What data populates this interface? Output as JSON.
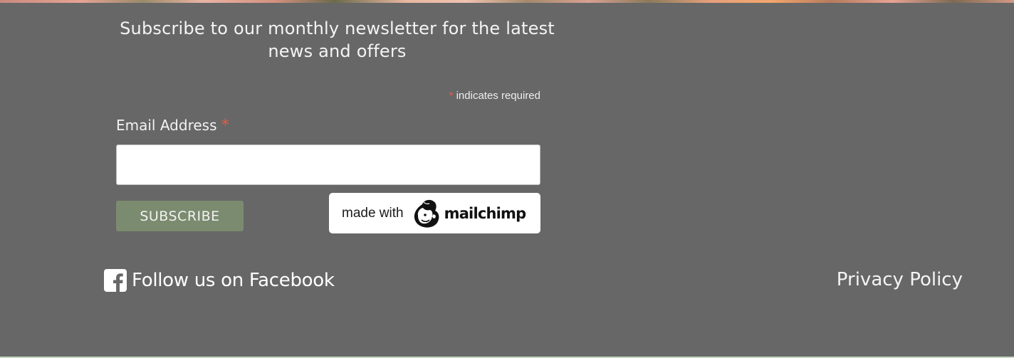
{
  "newsletter": {
    "heading_line1": "Subscribe to our monthly newsletter for the latest",
    "heading_line2": "news and offers",
    "required_asterisk": "*",
    "required_note": " indicates required",
    "email_label": "Email Address",
    "email_asterisk": "*",
    "email_value": "",
    "subscribe_label": "SUBSCRIBE"
  },
  "badge": {
    "made_with": "made with",
    "brand": "mailchimp",
    "icon": "mailchimp-freddie-logo"
  },
  "footer": {
    "facebook_icon": "facebook-square-icon",
    "facebook_label": "Follow us on Facebook",
    "privacy_label": "Privacy Policy"
  },
  "colors": {
    "background": "#676767",
    "subscribe_button": "#7b8b6f",
    "required_asterisk": "#e85c41",
    "badge_background": "#ffffff"
  }
}
